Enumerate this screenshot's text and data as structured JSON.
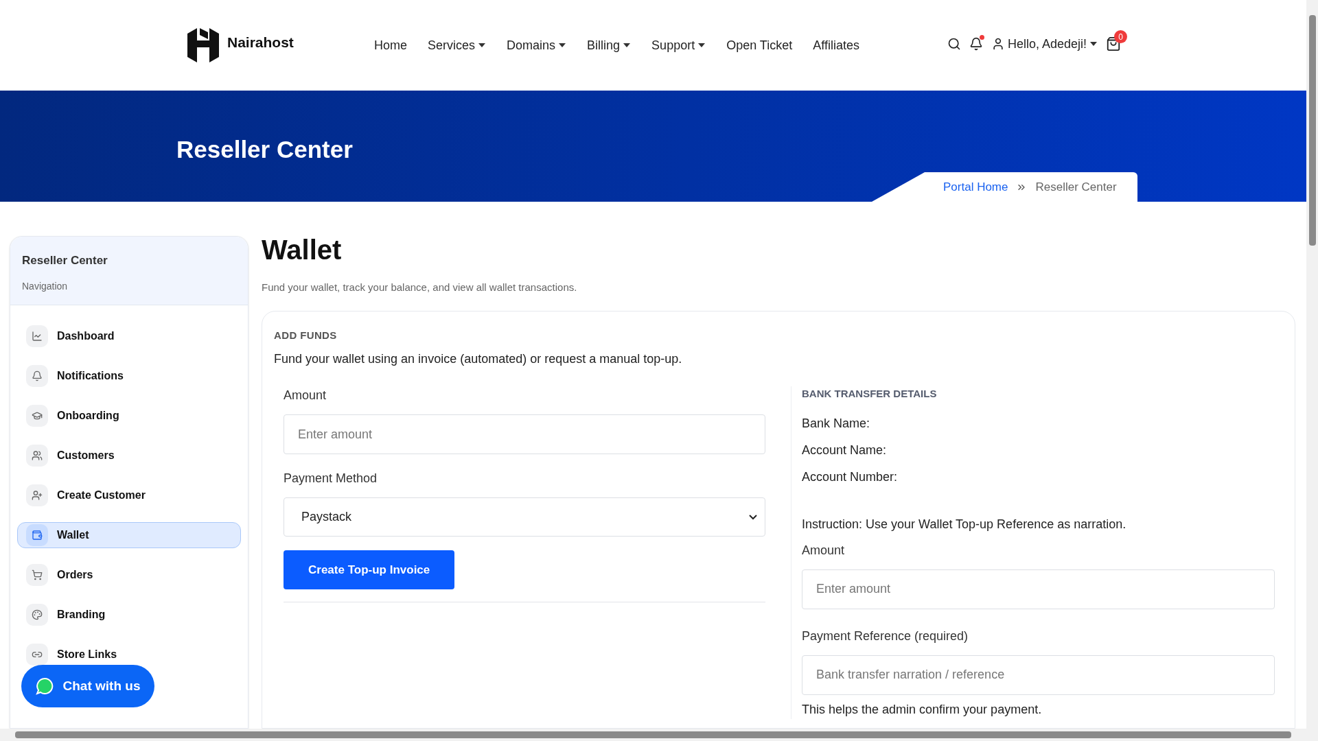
{
  "brand": {
    "name": "Nairahost"
  },
  "nav": [
    {
      "label": "Home",
      "has_menu": false
    },
    {
      "label": "Services",
      "has_menu": true
    },
    {
      "label": "Domains",
      "has_menu": true
    },
    {
      "label": "Billing",
      "has_menu": true
    },
    {
      "label": "Support",
      "has_menu": true
    },
    {
      "label": "Open Ticket",
      "has_menu": false
    },
    {
      "label": "Affiliates",
      "has_menu": false
    }
  ],
  "header_tools": {
    "notifications_unread": true,
    "user_greeting": "Hello, Adedeji!",
    "cart_count": "0"
  },
  "banner": {
    "title": "Reseller Center",
    "breadcrumb": [
      {
        "label": "Portal Home",
        "link": true
      },
      {
        "label": "Reseller Center",
        "link": false
      }
    ]
  },
  "sidebar": {
    "title": "Reseller Center",
    "subtitle": "Navigation",
    "items": [
      {
        "label": "Dashboard",
        "selected": false
      },
      {
        "label": "Notifications",
        "selected": false
      },
      {
        "label": "Onboarding",
        "selected": false
      },
      {
        "label": "Customers",
        "selected": false
      },
      {
        "label": "Create Customer",
        "selected": false
      },
      {
        "label": "Wallet",
        "selected": true
      },
      {
        "label": "Orders",
        "selected": false
      },
      {
        "label": "Branding",
        "selected": false
      },
      {
        "label": "Store Links",
        "selected": false
      }
    ]
  },
  "chat_button": {
    "label": "Chat with us"
  },
  "page": {
    "title": "Wallet",
    "subtitle": "Fund your wallet, track your balance, and view all wallet transactions."
  },
  "add_funds": {
    "heading": "ADD FUNDS",
    "description": "Fund your wallet using an invoice (automated) or request a manual top-up.",
    "amount": {
      "label": "Amount",
      "placeholder": "Enter amount"
    },
    "payment_method": {
      "label": "Payment Method",
      "value": "Paystack"
    },
    "submit": "Create Top-up Invoice"
  },
  "bank_transfer": {
    "heading": "BANK TRANSFER DETAILS",
    "details": [
      "Bank Name:",
      "Account Name:",
      "Account Number:"
    ],
    "instruction": "Instruction: Use your Wallet Top-up Reference as narration.",
    "amount": {
      "label": "Amount",
      "placeholder": "Enter amount"
    },
    "reference": {
      "label": "Payment Reference (required)",
      "placeholder": "Bank transfer narration / reference",
      "help": "This helps the admin confirm your payment."
    }
  }
}
